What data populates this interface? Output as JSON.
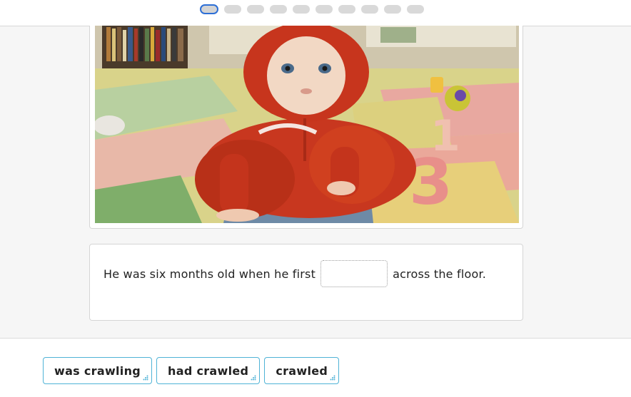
{
  "progress": {
    "total": 10,
    "current": 1
  },
  "sentence": {
    "before": "He was six months old when he first",
    "after": "across the floor."
  },
  "options": [
    {
      "label": "was crawling"
    },
    {
      "label": "had crawled"
    },
    {
      "label": "crawled"
    }
  ],
  "colors": {
    "active_dot": "#2d6fd6",
    "chip_border": "#4fb3d6"
  }
}
